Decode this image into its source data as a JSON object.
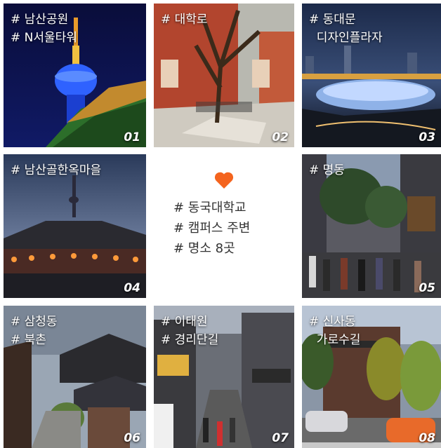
{
  "accent_color": "#f4641e",
  "center": {
    "icon": "heart-icon",
    "lines": [
      "# 동국대학교",
      "# 캠퍼스 주변",
      "# 명소 8곳"
    ]
  },
  "tiles": [
    {
      "tags": [
        "# 남산공원",
        "# N서울타워"
      ],
      "number": "01"
    },
    {
      "tags": [
        "# 대학로"
      ],
      "number": "02"
    },
    {
      "tags": [
        "# 동대문",
        "  디자인플라자"
      ],
      "number": "03"
    },
    {
      "tags": [
        "# 남산골한옥마을"
      ],
      "number": "04"
    },
    {
      "tags": [
        "# 명동"
      ],
      "number": "05"
    },
    {
      "tags": [
        "# 삼청동",
        "# 북촌"
      ],
      "number": "06"
    },
    {
      "tags": [
        "# 이태원",
        "# 경리단길"
      ],
      "number": "07"
    },
    {
      "tags": [
        "# 신사동",
        "  가로수길"
      ],
      "number": "08"
    }
  ]
}
